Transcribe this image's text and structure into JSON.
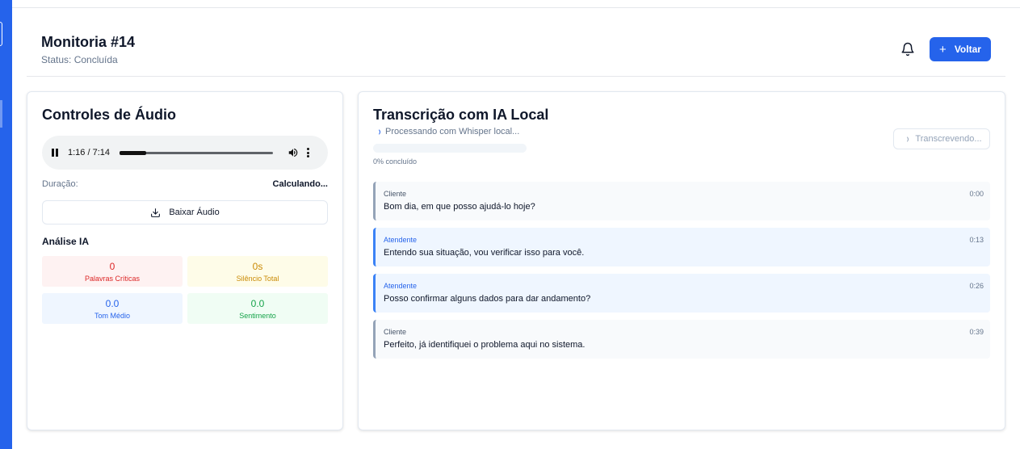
{
  "header": {
    "title": "Monitoria #14",
    "status": "Status: Concluída",
    "back_button": "Voltar",
    "back_icon": "plus-icon",
    "notification_icon": "bell-icon"
  },
  "audio_card": {
    "title": "Controles de Áudio",
    "player": {
      "current_time": "1:16",
      "total_time": "7:14",
      "time_display": "1:16 / 7:14",
      "progress_fraction": 0.175
    },
    "duration_label": "Duração:",
    "duration_value": "Calculando...",
    "download_button": "Baixar Áudio",
    "analysis_title": "Análise IA",
    "metrics": [
      {
        "value": "0",
        "label": "Palavras Críticas",
        "color": "#dc2626"
      },
      {
        "value": "0s",
        "label": "Silêncio Total",
        "color": "#ca8a04"
      },
      {
        "value": "0.0",
        "label": "Tom Médio",
        "color": "#2563eb"
      },
      {
        "value": "0.0",
        "label": "Sentimento",
        "color": "#16a34a"
      }
    ]
  },
  "transcription_card": {
    "title": "Transcrição com IA Local",
    "processing_text": "Processando com Whisper local...",
    "progress_percent": 0,
    "progress_text": "0% concluído",
    "transcribing_button": "Transcrevendo...",
    "lines": [
      {
        "speaker": "Cliente",
        "time": "0:00",
        "text": "Bom dia, em que posso ajudá-lo hoje?"
      },
      {
        "speaker": "Atendente",
        "time": "0:13",
        "text": "Entendo sua situação, vou verificar isso para você."
      },
      {
        "speaker": "Atendente",
        "time": "0:26",
        "text": "Posso confirmar alguns dados para dar andamento?"
      },
      {
        "speaker": "Cliente",
        "time": "0:39",
        "text": "Perfeito, já identifiquei o problema aqui no sistema."
      }
    ]
  },
  "colors": {
    "primary": "#2563eb",
    "sidebar": "#2563eb"
  }
}
